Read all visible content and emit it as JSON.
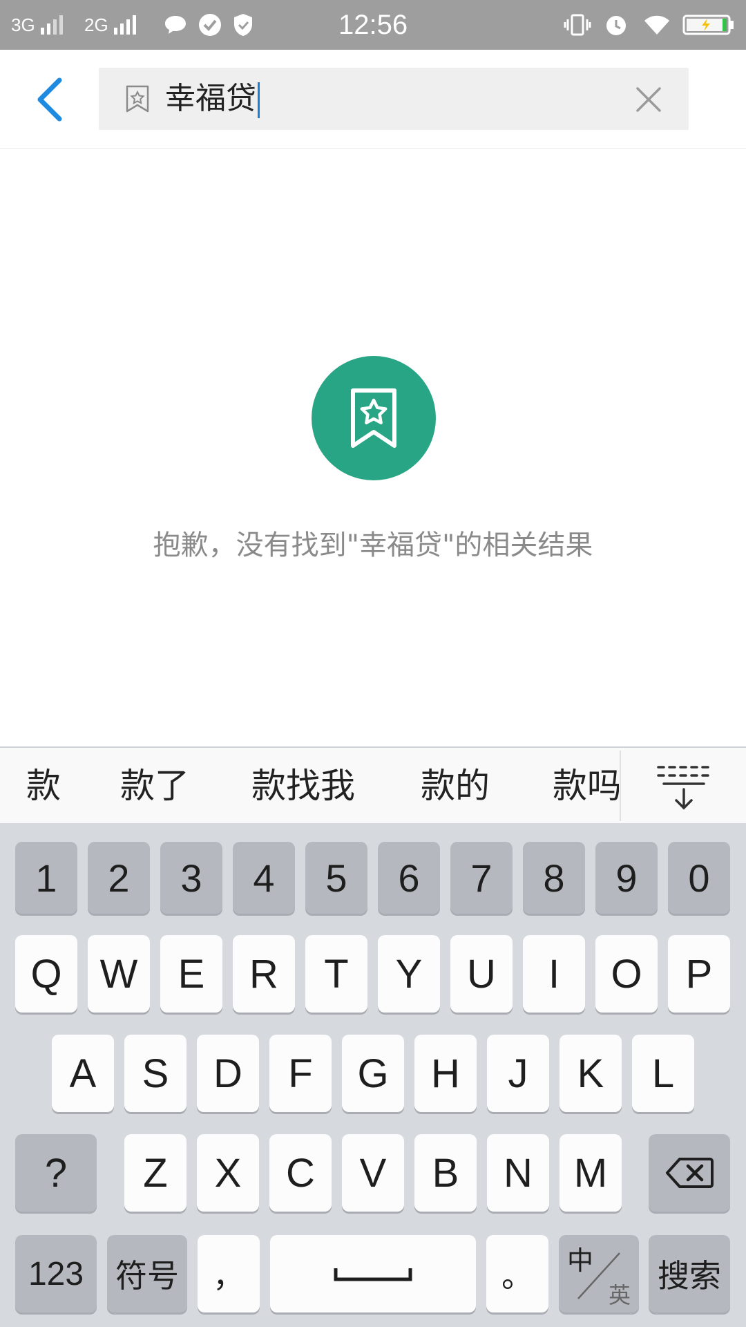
{
  "status_bar": {
    "network_1": "3G",
    "network_2": "2G",
    "time": "12:56"
  },
  "search": {
    "query": "幸福贷"
  },
  "empty_state": {
    "message": "抱歉，没有找到\"幸福贷\"的相关结果",
    "accent_color": "#27a584"
  },
  "candidates": [
    "款",
    "款了",
    "款找我",
    "款的",
    "款吗"
  ],
  "keyboard": {
    "row_digits": [
      "1",
      "2",
      "3",
      "4",
      "5",
      "6",
      "7",
      "8",
      "9",
      "0"
    ],
    "row_1": [
      "Q",
      "W",
      "E",
      "R",
      "T",
      "Y",
      "U",
      "I",
      "O",
      "P"
    ],
    "row_2": [
      "A",
      "S",
      "D",
      "F",
      "G",
      "H",
      "J",
      "K",
      "L"
    ],
    "row_3": [
      "Z",
      "X",
      "C",
      "V",
      "B",
      "N",
      "M"
    ],
    "question_key": "?",
    "numbers_key": "123",
    "symbols_key": "符号",
    "comma_key": "，",
    "period_key": "。",
    "lang_key_top": "中",
    "lang_key_bottom": "英",
    "search_key": "搜索"
  },
  "icons": {
    "back": "chevron-left-icon",
    "search": "bookmark-star-icon",
    "clear": "close-icon",
    "empty": "bookmark-star-icon",
    "collapse": "keyboard-collapse-icon",
    "backspace": "backspace-icon",
    "space": "space-bar-icon"
  }
}
